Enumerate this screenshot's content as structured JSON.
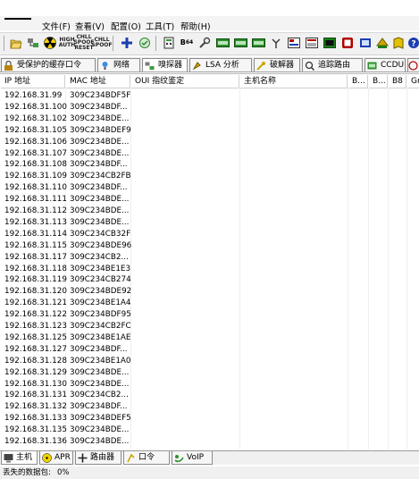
{
  "menu": {
    "items": [
      "文件(F)",
      "查看(V)",
      "配置(O)",
      "工具(T)",
      "帮助(H)"
    ]
  },
  "toolbar": {
    "icons": [
      {
        "name": "open-folder-icon",
        "color": "#d9a400"
      },
      {
        "name": "network-sniffer-icon",
        "color": "#1a6e1a"
      },
      {
        "name": "radioactive-icon",
        "color": "#d4b000"
      },
      {
        "name": "hash-auth-label",
        "text": "HIGH AUTH"
      },
      {
        "name": "chall-spoof-reset-label",
        "text": "CHLL SPOOF RESET"
      },
      {
        "name": "chall-spoof-label",
        "text": "CHLL SPOOF"
      },
      {
        "name": "add-plus-icon",
        "color": "#1b3fb0"
      },
      {
        "name": "cert-collector-icon",
        "color": "#2a8a2a"
      },
      {
        "name": "hash-calculator-icon",
        "color": "#333333"
      },
      {
        "name": "base64-icon",
        "text": "B 64"
      },
      {
        "name": "tools-icon",
        "color": "#444444"
      },
      {
        "name": "lm-hash-icon",
        "color": "#2f8f2f"
      },
      {
        "name": "ntlm-hash-icon",
        "color": "#2f8f2f"
      },
      {
        "name": "md5-hash-icon",
        "color": "#2f8f2f"
      },
      {
        "name": "wireless-icon",
        "color": "#333333"
      },
      {
        "name": "cisco-config-icon",
        "color": "#b00000"
      },
      {
        "name": "vnc-icon",
        "color": "#b00000"
      },
      {
        "name": "terminal-icon",
        "color": "#1b7d1b"
      },
      {
        "name": "rdp-icon",
        "color": "#b00000"
      },
      {
        "name": "ftp-icon",
        "color": "#1b3fb0"
      },
      {
        "name": "scanner-icon",
        "color": "#1b7d1b"
      },
      {
        "name": "book-icon",
        "color": "#c9a600"
      },
      {
        "name": "disk-icon",
        "color": "#1b3fb0"
      },
      {
        "name": "help-icon",
        "color": "#1b3fb0"
      }
    ]
  },
  "function_tabs": [
    {
      "label": "受保护的缓存口令",
      "icon": "lock-icon"
    },
    {
      "label": "网络",
      "icon": "network-icon"
    },
    {
      "label": "嗅探器",
      "icon": "sniffer-icon"
    },
    {
      "label": "LSA 分析",
      "icon": "lsa-icon"
    },
    {
      "label": "破解器",
      "icon": "cracker-icon"
    },
    {
      "label": "追踪路由",
      "icon": "traceroute-icon"
    },
    {
      "label": "CCDU",
      "icon": "ccdu-icon"
    }
  ],
  "table": {
    "headers": [
      "IP 地址",
      "MAC 地址",
      "OUI 指纹鉴定",
      "主机名称",
      "B...",
      "B...",
      "B8",
      "Gr"
    ],
    "rows": [
      [
        "192.168.31.99",
        "309C234BDF5F"
      ],
      [
        "192.168.31.100",
        "309C234BDF..."
      ],
      [
        "192.168.31.102",
        "309C234BDE..."
      ],
      [
        "192.168.31.105",
        "309C234BDEF9"
      ],
      [
        "192.168.31.106",
        "309C234BDE..."
      ],
      [
        "192.168.31.107",
        "309C234BDE..."
      ],
      [
        "192.168.31.108",
        "309C234BDF..."
      ],
      [
        "192.168.31.109",
        "309C234CB2FB"
      ],
      [
        "192.168.31.110",
        "309C234BDF..."
      ],
      [
        "192.168.31.111",
        "309C234BDE..."
      ],
      [
        "192.168.31.112",
        "309C234BDE..."
      ],
      [
        "192.168.31.113",
        "309C234BDE..."
      ],
      [
        "192.168.31.114",
        "309C234CB32F"
      ],
      [
        "192.168.31.115",
        "309C234BDE96"
      ],
      [
        "192.168.31.117",
        "309C234CB2..."
      ],
      [
        "192.168.31.118",
        "309C234BE1E3"
      ],
      [
        "192.168.31.119",
        "309C234CB274"
      ],
      [
        "192.168.31.120",
        "309C234BDE92"
      ],
      [
        "192.168.31.121",
        "309C234BE1A4"
      ],
      [
        "192.168.31.122",
        "309C234BDF95"
      ],
      [
        "192.168.31.123",
        "309C234CB2FC"
      ],
      [
        "192.168.31.125",
        "309C234BE1AE"
      ],
      [
        "192.168.31.127",
        "309C234BDF..."
      ],
      [
        "192.168.31.128",
        "309C234BE1A0"
      ],
      [
        "192.168.31.129",
        "309C234BDE..."
      ],
      [
        "192.168.31.130",
        "309C234BDE..."
      ],
      [
        "192.168.31.131",
        "309C234CB2..."
      ],
      [
        "192.168.31.132",
        "309C234BDF..."
      ],
      [
        "192.168.31.133",
        "309C234BDEF5"
      ],
      [
        "192.168.31.135",
        "309C234BDE..."
      ],
      [
        "192.168.31.136",
        "309C234BDE..."
      ]
    ]
  },
  "bottom_tabs": [
    {
      "label": "主机",
      "icon": "host-icon"
    },
    {
      "label": "APR",
      "icon": "apr-radioactive-icon"
    },
    {
      "label": "路由器",
      "icon": "router-icon"
    },
    {
      "label": "口令",
      "icon": "password-icon"
    },
    {
      "label": "VoIP",
      "icon": "voip-icon"
    }
  ],
  "status": {
    "lost_packets_label": "丢失的数据包:",
    "lost_packets_value": "0%"
  }
}
